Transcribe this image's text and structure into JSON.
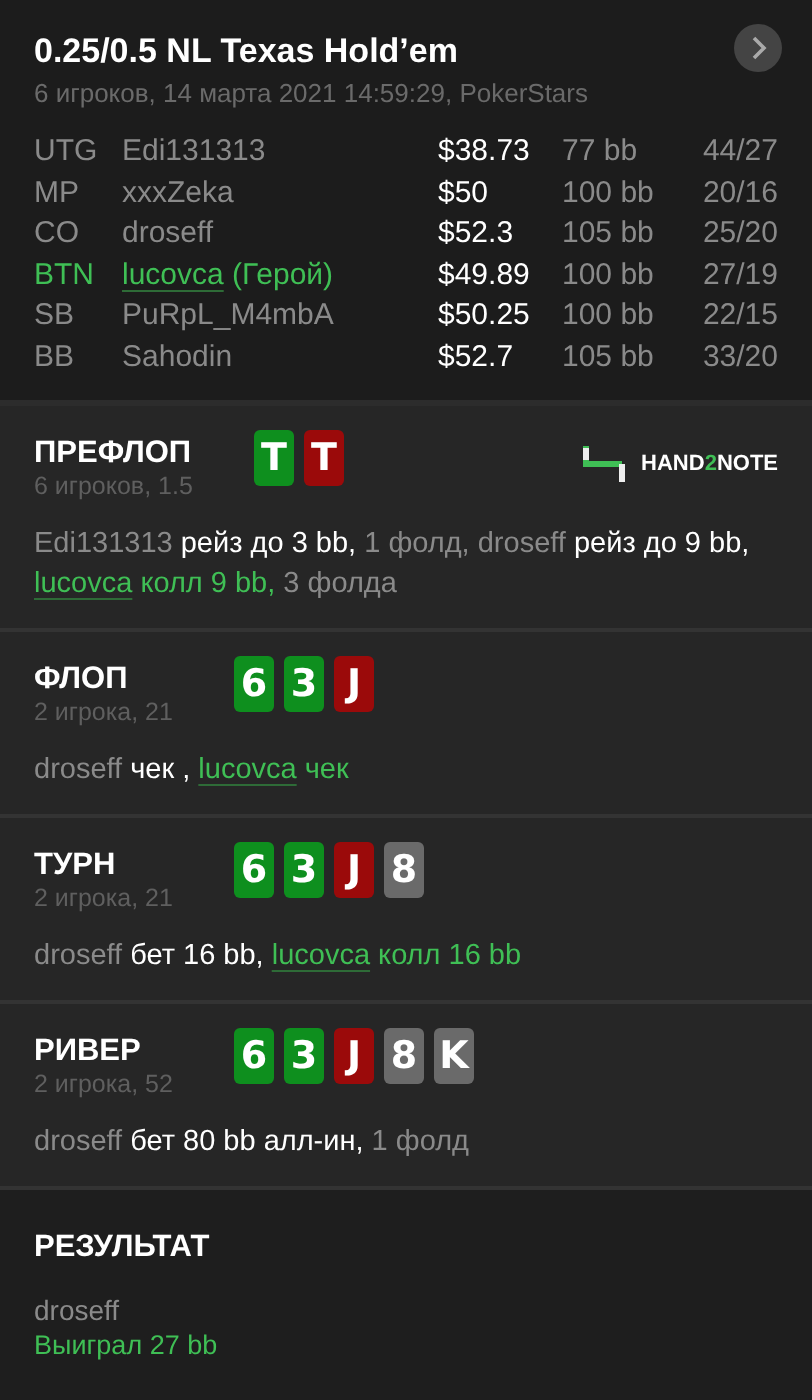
{
  "header": {
    "title": "0.25/0.5 NL Texas Hold’em",
    "subtitle": "6 игроков, 14 марта 2021 14:59:29, PokerStars"
  },
  "players": [
    {
      "position": "UTG",
      "name": "Edi131313",
      "hero": false,
      "stack": "$38.73",
      "bb": "77 bb",
      "stats": "44/27"
    },
    {
      "position": "MP",
      "name": "xxxZeka",
      "hero": false,
      "stack": "$50",
      "bb": "100 bb",
      "stats": "20/16"
    },
    {
      "position": "CO",
      "name": "droseff",
      "hero": false,
      "stack": "$52.3",
      "bb": "105 bb",
      "stats": "25/20"
    },
    {
      "position": "BTN",
      "name": "lucovca",
      "hero": true,
      "hero_label": "(Герой)",
      "stack": "$49.89",
      "bb": "100 bb",
      "stats": "27/19"
    },
    {
      "position": "SB",
      "name": "PuRpL_M4mbA",
      "hero": false,
      "stack": "$50.25",
      "bb": "100 bb",
      "stats": "22/15"
    },
    {
      "position": "BB",
      "name": "Sahodin",
      "hero": false,
      "stack": "$52.7",
      "bb": "105 bb",
      "stats": "33/20"
    }
  ],
  "logo": {
    "parts": [
      {
        "text": "HAND",
        "accent": false
      },
      {
        "text": "2",
        "accent": true
      },
      {
        "text": "NOTE",
        "accent": false
      }
    ]
  },
  "streets": [
    {
      "name": "ПРЕФЛОП",
      "info": "6 игроков, 1.5",
      "cards": [
        {
          "rank": "T",
          "color": "#0e8f1e"
        },
        {
          "rank": "T",
          "color": "#9b0a0a"
        }
      ],
      "actions": [
        {
          "kind": "player",
          "text": "Edi131313"
        },
        {
          "kind": "action",
          "text": " рейз до 3 bb,"
        },
        {
          "kind": "muted",
          "text": " 1 фолд, droseff"
        },
        {
          "kind": "action",
          "text": " рейз до 9 bb,"
        },
        {
          "kind": "hero",
          "text": "lucovca"
        },
        {
          "kind": "hero_action",
          "text": " колл 9 bb,"
        },
        {
          "kind": "muted",
          "text": " 3 фолда"
        }
      ]
    },
    {
      "name": "ФЛОП",
      "info": "2 игрока, 21",
      "cards": [
        {
          "rank": "6",
          "color": "#0e8f1e"
        },
        {
          "rank": "3",
          "color": "#0e8f1e"
        },
        {
          "rank": "J",
          "color": "#9b0a0a"
        }
      ],
      "actions": [
        {
          "kind": "player",
          "text": "droseff"
        },
        {
          "kind": "action",
          "text": " чек ,"
        },
        {
          "kind": "hero",
          "text": "lucovca"
        },
        {
          "kind": "hero_action",
          "text": " чек"
        }
      ]
    },
    {
      "name": "ТУРН",
      "info": "2 игрока, 21",
      "cards": [
        {
          "rank": "6",
          "color": "#0e8f1e"
        },
        {
          "rank": "3",
          "color": "#0e8f1e"
        },
        {
          "rank": "J",
          "color": "#9b0a0a"
        },
        {
          "rank": "8",
          "color": "#6a6a6a"
        }
      ],
      "actions": [
        {
          "kind": "player",
          "text": "droseff"
        },
        {
          "kind": "action",
          "text": " бет 16 bb,"
        },
        {
          "kind": "hero",
          "text": "lucovca"
        },
        {
          "kind": "hero_action",
          "text": " колл 16 bb"
        }
      ]
    },
    {
      "name": "РИВЕР",
      "info": "2 игрока, 52",
      "cards": [
        {
          "rank": "6",
          "color": "#0e8f1e"
        },
        {
          "rank": "3",
          "color": "#0e8f1e"
        },
        {
          "rank": "J",
          "color": "#9b0a0a"
        },
        {
          "rank": "8",
          "color": "#6a6a6a"
        },
        {
          "rank": "K",
          "color": "#6a6a6a"
        }
      ],
      "actions": [
        {
          "kind": "player",
          "text": "droseff"
        },
        {
          "kind": "action",
          "text": " бет 80 bb алл-ин,"
        },
        {
          "kind": "muted",
          "text": " 1 фолд"
        }
      ]
    }
  ],
  "result": {
    "title": "РЕЗУЛЬТАТ",
    "player": "droseff",
    "outcome": "Выиграл 27 bb"
  }
}
